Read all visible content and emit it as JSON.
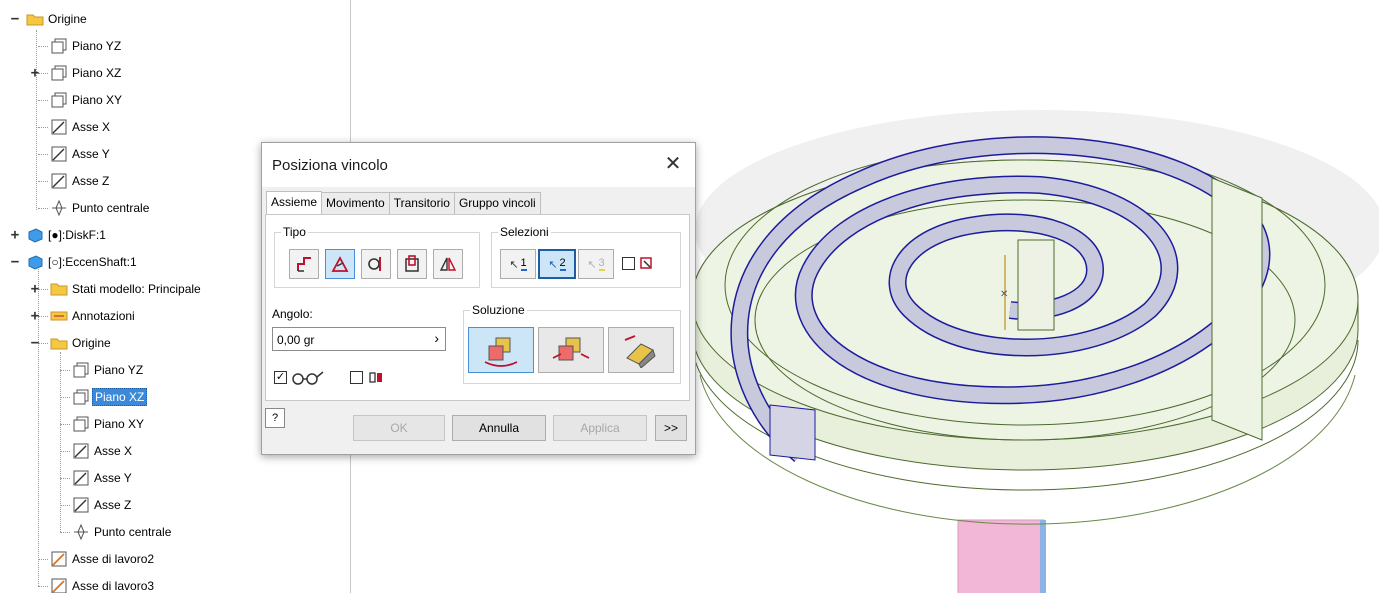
{
  "browser": {
    "items": [
      {
        "label": "Origine",
        "icon": "folder-icon"
      },
      {
        "label": "Piano YZ",
        "icon": "work-plane-icon"
      },
      {
        "label": "Piano XZ",
        "icon": "work-plane-icon"
      },
      {
        "label": "Piano XY",
        "icon": "work-plane-icon"
      },
      {
        "label": "Asse X",
        "icon": "work-axis-icon"
      },
      {
        "label": "Asse Y",
        "icon": "work-axis-icon"
      },
      {
        "label": "Asse Z",
        "icon": "work-axis-icon"
      },
      {
        "label": "Punto centrale",
        "icon": "center-point-icon"
      },
      {
        "label": "[●]:DiskF:1",
        "icon": "part-icon"
      },
      {
        "label": "[○]:EccenShaft:1",
        "icon": "part-icon"
      },
      {
        "label": "Stati modello: Principale",
        "icon": "model-states-icon"
      },
      {
        "label": "Annotazioni",
        "icon": "annotations-icon"
      },
      {
        "label": "Origine",
        "icon": "folder-icon"
      },
      {
        "label": "Piano YZ",
        "icon": "work-plane-icon"
      },
      {
        "label": "Piano XZ",
        "icon": "work-plane-icon",
        "selected": true
      },
      {
        "label": "Piano XY",
        "icon": "work-plane-icon"
      },
      {
        "label": "Asse X",
        "icon": "work-axis-icon"
      },
      {
        "label": "Asse Y",
        "icon": "work-axis-icon"
      },
      {
        "label": "Asse Z",
        "icon": "work-axis-icon"
      },
      {
        "label": "Punto centrale",
        "icon": "center-point-icon"
      },
      {
        "label": "Asse di lavoro2",
        "icon": "work-axis-orange-icon"
      },
      {
        "label": "Asse di lavoro3",
        "icon": "work-axis-orange-icon"
      }
    ]
  },
  "dialog": {
    "title": "Posiziona vincolo",
    "tabs": [
      "Assieme",
      "Movimento",
      "Transitorio",
      "Gruppo vincoli"
    ],
    "active_tab": "Assieme",
    "type_group_label": "Tipo",
    "type_buttons": [
      "mate-icon",
      "angle-icon",
      "tangent-icon",
      "insert-icon",
      "symmetry-icon"
    ],
    "selections_group_label": "Selezioni",
    "selections": [
      "1",
      "2",
      "3"
    ],
    "angle_label": "Angolo:",
    "angle_value": "0,00 gr",
    "solution_group_label": "Soluzione",
    "solution_buttons": [
      "directed-angle-icon",
      "undirected-angle-icon",
      "explicit-reference-vector-icon"
    ],
    "ok_label": "OK",
    "cancel_label": "Annulla",
    "apply_label": "Applica",
    "more_label": ">>"
  },
  "colors": {
    "accent": "#3b89d8",
    "spiral_edge": "#1c1c9c",
    "spiral_face": "#c8c8dc",
    "part_face": "#e8f0dc",
    "shaft": "#f0b8d8"
  }
}
